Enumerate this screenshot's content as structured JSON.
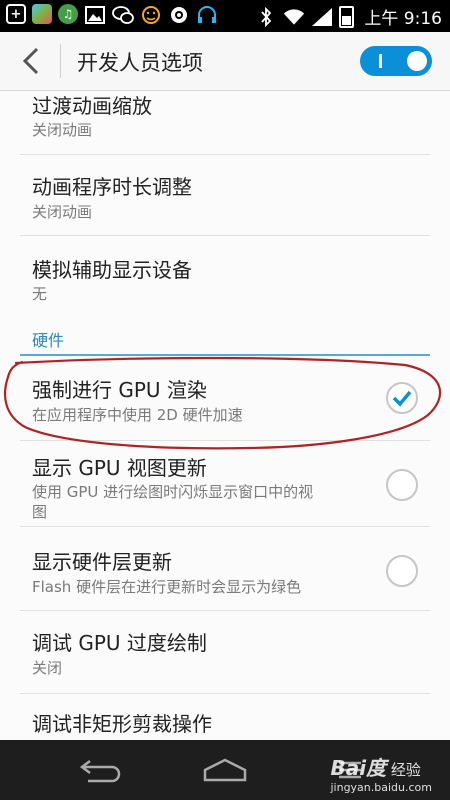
{
  "status_bar": {
    "time": "上午 9:16",
    "left_icons": [
      "plus-box-icon",
      "app-gradient-icon",
      "notification-green-icon",
      "image-icon",
      "wechat-icon",
      "face-icon",
      "settings-icon",
      "headset-icon"
    ],
    "right_icons": [
      "bluetooth-icon",
      "wifi-icon",
      "signal-icon",
      "battery-icon"
    ]
  },
  "action_bar": {
    "title": "开发人员选项",
    "toggle_on": true
  },
  "items": [
    {
      "title": "过渡动画缩放",
      "subtitle": "关闭动画"
    },
    {
      "title": "动画程序时长调整",
      "subtitle": "关闭动画"
    },
    {
      "title": "模拟辅助显示设备",
      "subtitle": "无"
    }
  ],
  "section": {
    "title": "硬件"
  },
  "checkbox_items": [
    {
      "title": "强制进行 GPU 渲染",
      "subtitle": "在应用程序中使用 2D 硬件加速",
      "checked": true
    },
    {
      "title": "显示 GPU 视图更新",
      "subtitle_line1": "使用 GPU 进行绘图时闪烁显示窗口中的视",
      "subtitle_line2": "图",
      "checked": false
    },
    {
      "title": "显示硬件层更新",
      "subtitle": "Flash 硬件层在进行更新时会显示为绿色",
      "checked": false
    }
  ],
  "more_items": [
    {
      "title": "调试 GPU 过度绘制",
      "subtitle": "关闭"
    },
    {
      "title": "调试非矩形剪裁操作"
    }
  ],
  "watermark": {
    "logo": "Bai度",
    "text": "经验",
    "url": "jingyan.baidu.com"
  },
  "colors": {
    "accent": "#0a8fd8",
    "section": "#2b89c7",
    "annotation": "#b22222"
  }
}
